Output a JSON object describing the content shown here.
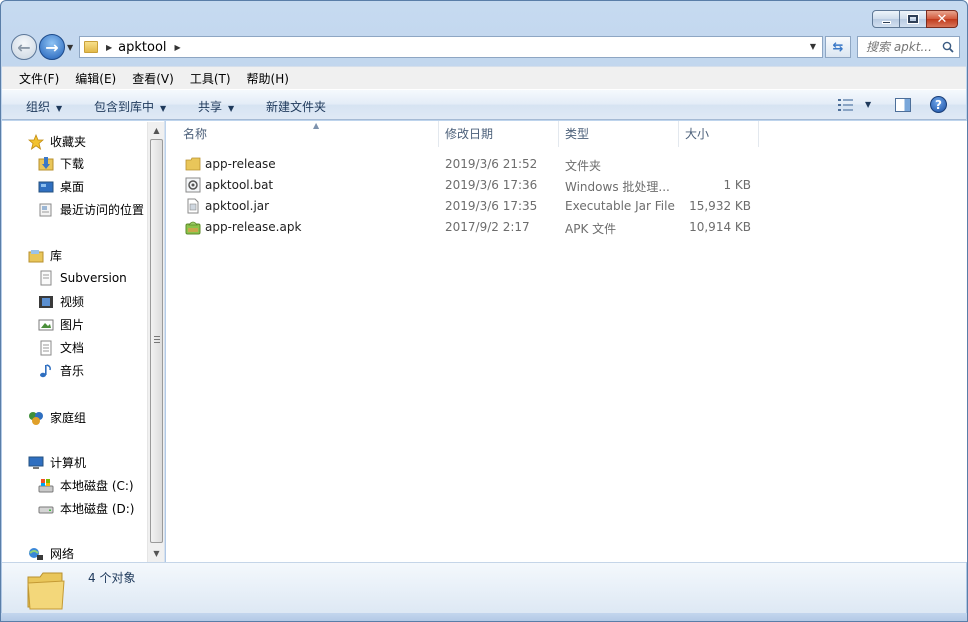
{
  "window": {
    "caption_buttons": {
      "close_glyph": "✕"
    }
  },
  "nav": {
    "address_path": "apktool",
    "search_placeholder": "搜索 apkt..."
  },
  "menubar": {
    "items": [
      "文件(F)",
      "编辑(E)",
      "查看(V)",
      "工具(T)",
      "帮助(H)"
    ]
  },
  "commandbar": {
    "organize": "组织",
    "include_in_library": "包含到库中",
    "share": "共享",
    "new_folder": "新建文件夹"
  },
  "sidebar": {
    "favorites": {
      "label": "收藏夹",
      "items": [
        "下载",
        "桌面",
        "最近访问的位置"
      ]
    },
    "libraries": {
      "label": "库",
      "items": [
        "Subversion",
        "视频",
        "图片",
        "文档",
        "音乐"
      ]
    },
    "homegroup": {
      "label": "家庭组"
    },
    "computer": {
      "label": "计算机",
      "items": [
        "本地磁盘 (C:)",
        "本地磁盘 (D:)"
      ]
    },
    "network": {
      "label": "网络"
    }
  },
  "filelist": {
    "columns": [
      "名称",
      "修改日期",
      "类型",
      "大小"
    ],
    "rows": [
      {
        "name": "app-release",
        "modified": "2019/3/6 21:52",
        "type": "文件夹",
        "size": "",
        "icon": "folder-icon"
      },
      {
        "name": "apktool.bat",
        "modified": "2019/3/6 17:36",
        "type": "Windows 批处理...",
        "size": "1 KB",
        "icon": "batch-file-icon"
      },
      {
        "name": "apktool.jar",
        "modified": "2019/3/6 17:35",
        "type": "Executable Jar File",
        "size": "15,932 KB",
        "icon": "jar-file-icon"
      },
      {
        "name": "app-release.apk",
        "modified": "2017/9/2 2:17",
        "type": "APK 文件",
        "size": "10,914 KB",
        "icon": "apk-file-icon"
      }
    ]
  },
  "details": {
    "item_count": "4 个对象"
  },
  "colors": {
    "frame": "#b6cde9",
    "accent": "#1e395b",
    "folder": "#e2b94a"
  }
}
